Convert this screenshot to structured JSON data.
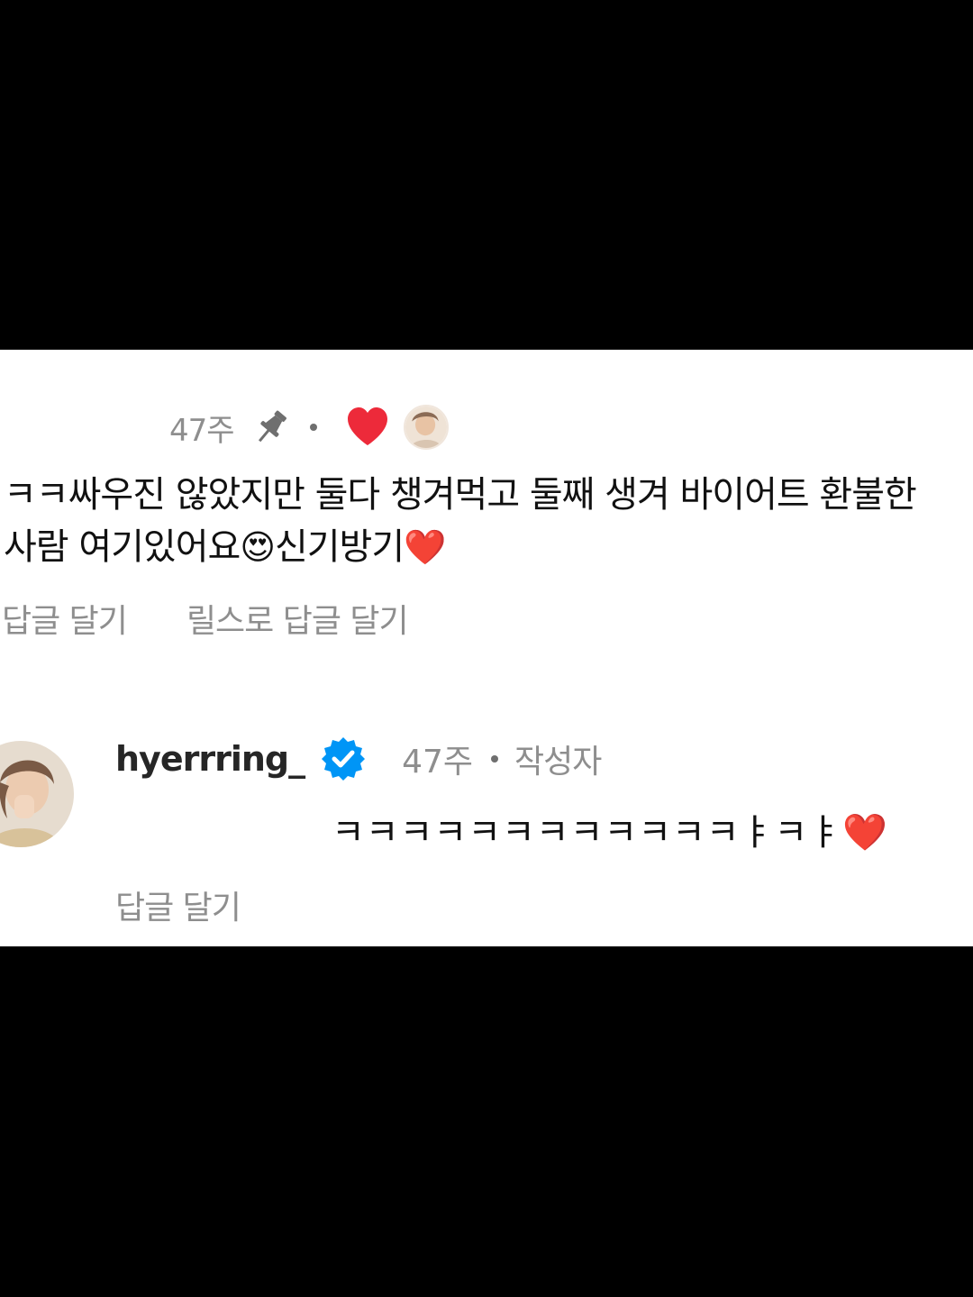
{
  "comment": {
    "time": "47주",
    "text_part1": "ㅋㅋ싸우진 않았지만 둘다 챙겨먹고 둘째 생겨 바이어트 환불한 사람 여기있어요",
    "emoji_smile": "😍",
    "text_part2": "신기방기",
    "emoji_heart": "❤️",
    "actions": {
      "reply": "답글 달기",
      "reels_reply": "릴스로 답글 달기"
    },
    "liked_color": "#ed2a3a",
    "icons": [
      "pin-icon",
      "heart-liked-icon",
      "creator-avatar"
    ]
  },
  "reply": {
    "username": "hyerrring_",
    "time": "47주",
    "author_label": "작성자",
    "text": "ㅋㅋㅋㅋㅋㅋㅋㅋㅋㅋㅋㅋㅑㅋㅑ",
    "emoji_heart": "❤️",
    "actions": {
      "reply": "답글 달기"
    },
    "verified_color": "#0095f6",
    "icons": [
      "verified-badge-icon",
      "avatar"
    ]
  }
}
